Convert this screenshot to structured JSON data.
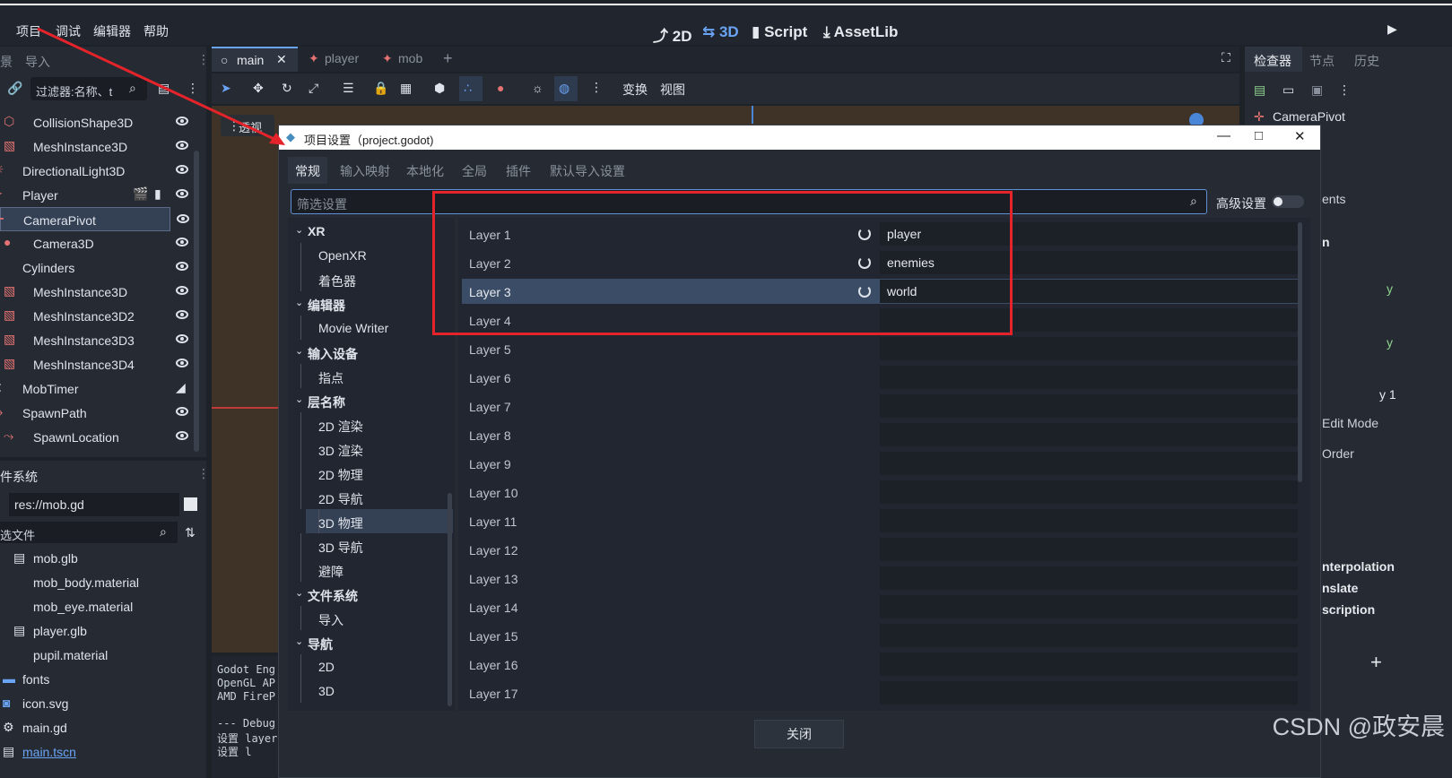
{
  "menu": {
    "project": "项目",
    "debug": "调试",
    "editor": "编辑器",
    "help": "帮助"
  },
  "workspaces": {
    "w2d": "2D",
    "w3d": "3D",
    "script": "Script",
    "assetlib": "AssetLib"
  },
  "left_top": {
    "tab_scene": "景",
    "tab_import": "导入",
    "filter_placeholder": "过滤器:名称、t"
  },
  "scene_tree": [
    "CollisionShape3D",
    "MeshInstance3D",
    "DirectionalLight3D",
    "Player",
    "CameraPivot",
    "Camera3D",
    "Cylinders",
    "MeshInstance3D",
    "MeshInstance3D2",
    "MeshInstance3D3",
    "MeshInstance3D4",
    "MobTimer",
    "SpawnPath",
    "SpawnLocation"
  ],
  "filesystem": {
    "title": "件系统",
    "path": "res://mob.gd",
    "filter": "选文件",
    "items": [
      "mob.glb",
      "mob_body.material",
      "mob_eye.material",
      "player.glb",
      "pupil.material",
      "fonts",
      "icon.svg",
      "main.gd",
      "main.tscn"
    ]
  },
  "editor_tabs": {
    "main": "main",
    "player": "player",
    "mob": "mob"
  },
  "viewport": {
    "perspective": "透视",
    "transform": "变换",
    "view": "视图"
  },
  "output": [
    "Godot Eng",
    "OpenGL AP",
    "AMD FireP",
    "",
    "--- Debug",
    "设置 layer",
    "设置 l"
  ],
  "inspector": {
    "tab1": "检查器",
    "tab2": "节点",
    "tab3": "历史",
    "node": "CameraPivot",
    "frag": [
      "ents",
      "n",
      "y",
      "y",
      "y 1",
      "Edit Mode",
      "Order",
      "nterpolation",
      "nslate",
      "scription"
    ]
  },
  "dialog": {
    "title": "项目设置（project.godot)",
    "tabs": [
      "常规",
      "输入映射",
      "本地化",
      "全局",
      "插件",
      "默认导入设置"
    ],
    "search_placeholder": "筛选设置",
    "advanced": "高级设置",
    "sections": [
      {
        "t": "XR",
        "h": true
      },
      {
        "t": "OpenXR"
      },
      {
        "t": "着色器"
      },
      {
        "t": "编辑器",
        "h": true
      },
      {
        "t": "Movie Writer"
      },
      {
        "t": "输入设备",
        "h": true
      },
      {
        "t": "指点"
      },
      {
        "t": "层名称",
        "h": true
      },
      {
        "t": "2D 渲染"
      },
      {
        "t": "3D 渲染"
      },
      {
        "t": "2D 物理"
      },
      {
        "t": "2D 导航"
      },
      {
        "t": "3D 物理",
        "sel": true
      },
      {
        "t": "3D 导航"
      },
      {
        "t": "避障"
      },
      {
        "t": "文件系统",
        "h": true
      },
      {
        "t": "导入"
      },
      {
        "t": "导航",
        "h": true
      },
      {
        "t": "2D"
      },
      {
        "t": "3D"
      }
    ],
    "layers": [
      {
        "name": "Layer 1",
        "value": "player"
      },
      {
        "name": "Layer 2",
        "value": "enemies"
      },
      {
        "name": "Layer 3",
        "value": "world"
      },
      {
        "name": "Layer 4",
        "value": ""
      },
      {
        "name": "Layer 5",
        "value": ""
      },
      {
        "name": "Layer 6",
        "value": ""
      },
      {
        "name": "Layer 7",
        "value": ""
      },
      {
        "name": "Layer 8",
        "value": ""
      },
      {
        "name": "Layer 9",
        "value": ""
      },
      {
        "name": "Layer 10",
        "value": ""
      },
      {
        "name": "Layer 11",
        "value": ""
      },
      {
        "name": "Layer 12",
        "value": ""
      },
      {
        "name": "Layer 13",
        "value": ""
      },
      {
        "name": "Layer 14",
        "value": ""
      },
      {
        "name": "Layer 15",
        "value": ""
      },
      {
        "name": "Layer 16",
        "value": ""
      },
      {
        "name": "Layer 17",
        "value": ""
      }
    ],
    "close": "关闭"
  },
  "watermark": "CSDN @政安晨",
  "colors": {
    "accent": "#5f8fd6",
    "annotation": "#e5232a",
    "selected_row": "#3b4c66"
  }
}
